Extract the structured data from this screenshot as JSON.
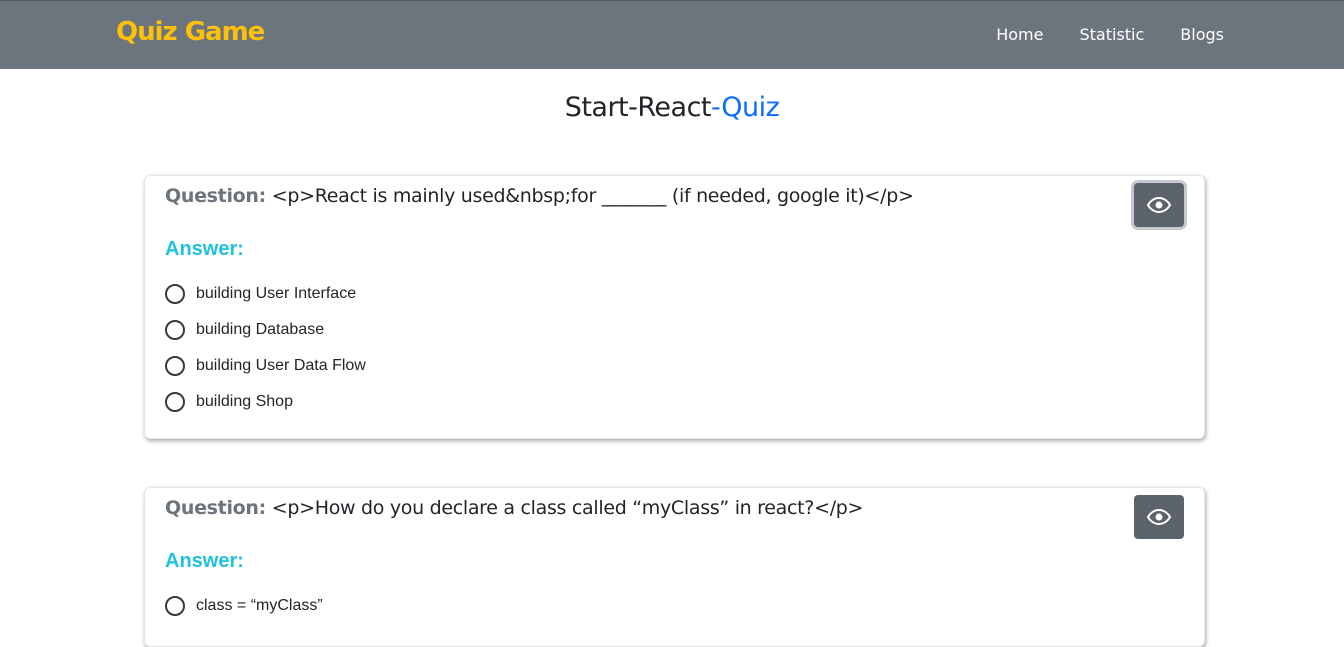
{
  "nav": {
    "brand": "Quiz Game",
    "links": [
      "Home",
      "Statistic",
      "Blogs"
    ]
  },
  "title": {
    "main": "Start-React",
    "accent": "-Quiz"
  },
  "questions": [
    {
      "label": "Question:",
      "text": "<p>React is mainly used&nbsp;for _______ (if needed, google it)</p>",
      "answer_label": "Answer:",
      "options": [
        "building User Interface",
        "building Database",
        "building User Data Flow",
        "building Shop"
      ]
    },
    {
      "label": "Question:",
      "text": "<p>How do you declare a class called “myClass” in react?</p>",
      "answer_label": "Answer:",
      "options": [
        "class = “myClass”"
      ]
    }
  ],
  "colors": {
    "navbar": "#6c757d",
    "brand": "#ffc107",
    "title_accent": "#0d6efd",
    "answer_label": "#1ec2e0",
    "eye_button": "#5c636a"
  },
  "icons": {
    "eye": "eye-icon"
  }
}
